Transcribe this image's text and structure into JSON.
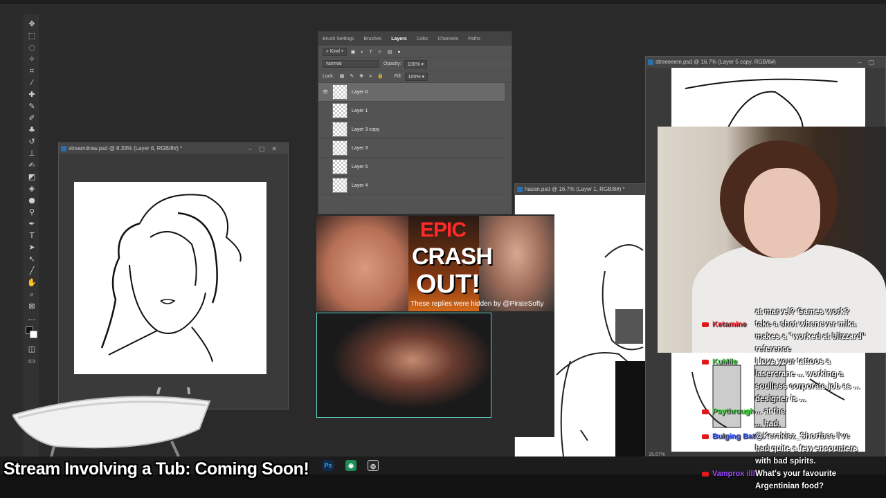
{
  "ps_tabs": {
    "brush_settings": "Brush Settings",
    "brushes": "Brushes",
    "layers": "Layers",
    "color": "Color",
    "channels": "Channels",
    "paths": "Paths"
  },
  "ps_controls": {
    "kind": "Kind",
    "blend": "Normal",
    "opacity_label": "Opacity:",
    "opacity": "100%",
    "lock_label": "Lock:",
    "fill_label": "Fill:",
    "fill": "100%"
  },
  "layers": [
    {
      "name": "Layer 6",
      "selected": true
    },
    {
      "name": "Layer 1",
      "selected": false
    },
    {
      "name": "Layer 3 copy",
      "selected": false
    },
    {
      "name": "Layer 3",
      "selected": false
    },
    {
      "name": "Layer 5",
      "selected": false
    },
    {
      "name": "Layer 4",
      "selected": false
    }
  ],
  "windows": {
    "streamdraw": "streamdraw.psd @ 8.33% (Layer 6, RGB/8#) *",
    "hasan": "hasan.psd @ 16.7% (Layer 1, RGB/8#) *",
    "streeeeem": "streeeeem.psd @ 16.7% (Layer 5 copy, RGB/8#)",
    "zoom_status": "16.67%"
  },
  "thumbnail": {
    "epic": "EPIC",
    "crash": "CRASH",
    "out": "OUT!",
    "hidden_note": "These replies were hidden by @PirateSofty"
  },
  "chat": [
    {
      "user": "",
      "color": "#ffffff",
      "text": "at marvel? Games work?"
    },
    {
      "user": "Ketamine",
      "color": "#ff2a3a",
      "text": "take a shot whenever mika"
    },
    {
      "user": "",
      "color": "#ffffff",
      "text": "makes a \"worked at blizzard\""
    },
    {
      "user": "",
      "color": "#ffffff",
      "text": "reference"
    },
    {
      "user": "KuMile",
      "color": "#3cd03c",
      "text": "I love your tattoos a"
    },
    {
      "user": "",
      "color": "#ffffff",
      "text": "lasercrane ... working a"
    },
    {
      "user": "",
      "color": "#ffffff",
      "text": "soulless corporate job as ..."
    },
    {
      "user": "",
      "color": "#ffffff",
      "text": "designer is ..."
    },
    {
      "user": "Psythrough",
      "color": "#3cd03c",
      "text": "... at the"
    },
    {
      "user": "",
      "color": "#ffffff",
      "text": "... had."
    },
    {
      "user": "Bulging Batt...",
      "color": "#3a5aff",
      "text": "@Kerakisz_Shortbee I've"
    },
    {
      "user": "",
      "color": "#ffffff",
      "text": "had quite a few encounters"
    },
    {
      "user": "",
      "color": "#ffffff",
      "text": "with bad spirits."
    },
    {
      "user": "Vamprox illl",
      "color": "#a04aff",
      "text": "What's your favourite"
    },
    {
      "user": "",
      "color": "#ffffff",
      "text": "Argentinian food?"
    }
  ],
  "overlay_title": "Stream Involving a Tub: Coming Soon!",
  "taskbar": {
    "ps": "Ps"
  }
}
